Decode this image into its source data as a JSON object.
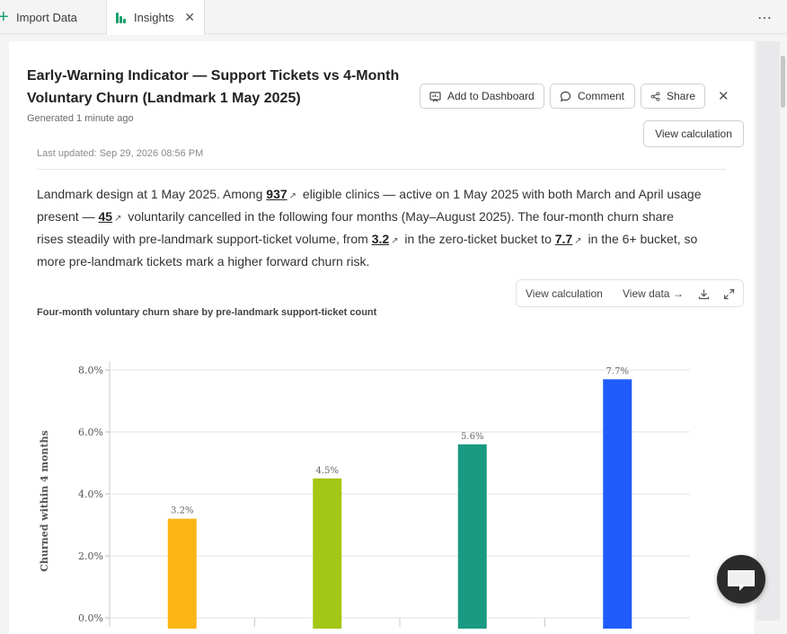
{
  "tabs": {
    "import_label": "Import Data",
    "insights_label": "Insights",
    "close_glyph": "✕",
    "more_glyph": "⋯"
  },
  "header": {
    "title": "Early-Warning Indicator — Support Tickets vs 4-Month Voluntary Churn (Landmark 1 May 2025)",
    "generated": "Generated 1 minute ago",
    "buttons": {
      "add_to_dashboard": "Add to Dashboard",
      "comment": "Comment",
      "share": "Share",
      "view_calculation": "View calculation",
      "close_glyph": "✕"
    },
    "last_updated": "Last updated: Sep 29, 2026 08:56 PM"
  },
  "summary": {
    "p1": "Landmark design at 1 May 2025. Among ",
    "n_eligible": "937",
    "p2": " eligible clinics — active on 1 May 2025 with both March and April usage present — ",
    "n_cancelled": "45",
    "p3": " voluntarily cancelled in the following four months (May–August 2025). The four-month churn share rises steadily with pre-landmark support-ticket volume, from ",
    "v_low": "3.2",
    "p4": " in the zero-ticket bucket to ",
    "v_high": "7.7",
    "p5": " in the 6+ bucket, so more pre-landmark tickets mark a higher forward churn risk."
  },
  "chart_tools": {
    "view_calculation": "View calculation",
    "view_data": "View data →"
  },
  "chart_data": {
    "type": "bar",
    "title": "Four-month voluntary churn share by pre-landmark support-ticket count",
    "ylabel": "Churned within 4 months",
    "ylim": [
      0,
      8
    ],
    "yticks": [
      "0.0%",
      "2.0%",
      "4.0%",
      "6.0%",
      "8.0%"
    ],
    "values": [
      3.2,
      4.5,
      5.6,
      7.7
    ],
    "data_labels": [
      "3.2%",
      "4.5%",
      "5.6%",
      "7.7%"
    ],
    "colors": [
      "#fbb516",
      "#a4c614",
      "#1a9a82",
      "#1f5cfb"
    ],
    "grid": true
  },
  "colors": {
    "accent": "#1aa06d",
    "card": "#ffffff",
    "chat": "#2b2b2b"
  }
}
